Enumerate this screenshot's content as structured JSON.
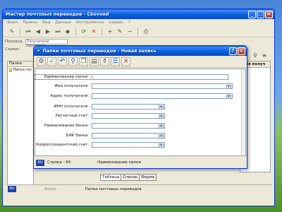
{
  "main_window": {
    "title": "Мастер почтовых переводов - Cbsvoed",
    "menu": [
      "Файл",
      "Правка",
      "Вид",
      "Данные",
      "Инструменты",
      "Сервис",
      "?"
    ],
    "row2_label": "Перевод",
    "row2_field": "Получатели переводов",
    "row3_label": "Сервис",
    "left_panel_header": "Папки",
    "folder_item": "Папки почтовых",
    "right_column_header": "Имя получ",
    "tabs": [
      "Таблица",
      "Список",
      "Форма"
    ],
    "status": {
      "lang": "RU",
      "left": "Фокус",
      "center": "Папки почтовых переводов"
    }
  },
  "dialog": {
    "title": "Папки почтовых переводов - Новая запись",
    "fields": [
      {
        "label": "Наименование папки :",
        "value": "",
        "dropdown": false
      },
      {
        "label": "Имя получателя :",
        "value": "",
        "dropdown": true
      },
      {
        "label": "Адрес получателя :",
        "value": "",
        "dropdown": true
      },
      {
        "label": "ИНН получателя :",
        "value": "",
        "dropdown": true
      },
      {
        "label": "Расчетный счет :",
        "value": "",
        "dropdown": true
      },
      {
        "label": "Наименование банка :",
        "value": "",
        "dropdown": true
      },
      {
        "label": "БИК банка :",
        "value": "",
        "dropdown": true
      },
      {
        "label": "Корреспондентский счет :",
        "value": "",
        "dropdown": true
      }
    ],
    "status": {
      "lang": "RU",
      "row": "Строка - 64",
      "field": "Наименование папки"
    }
  },
  "colors": {
    "title_blue": "#0553d4",
    "close_red": "#c1381b",
    "window_bg": "#ece9d8"
  }
}
